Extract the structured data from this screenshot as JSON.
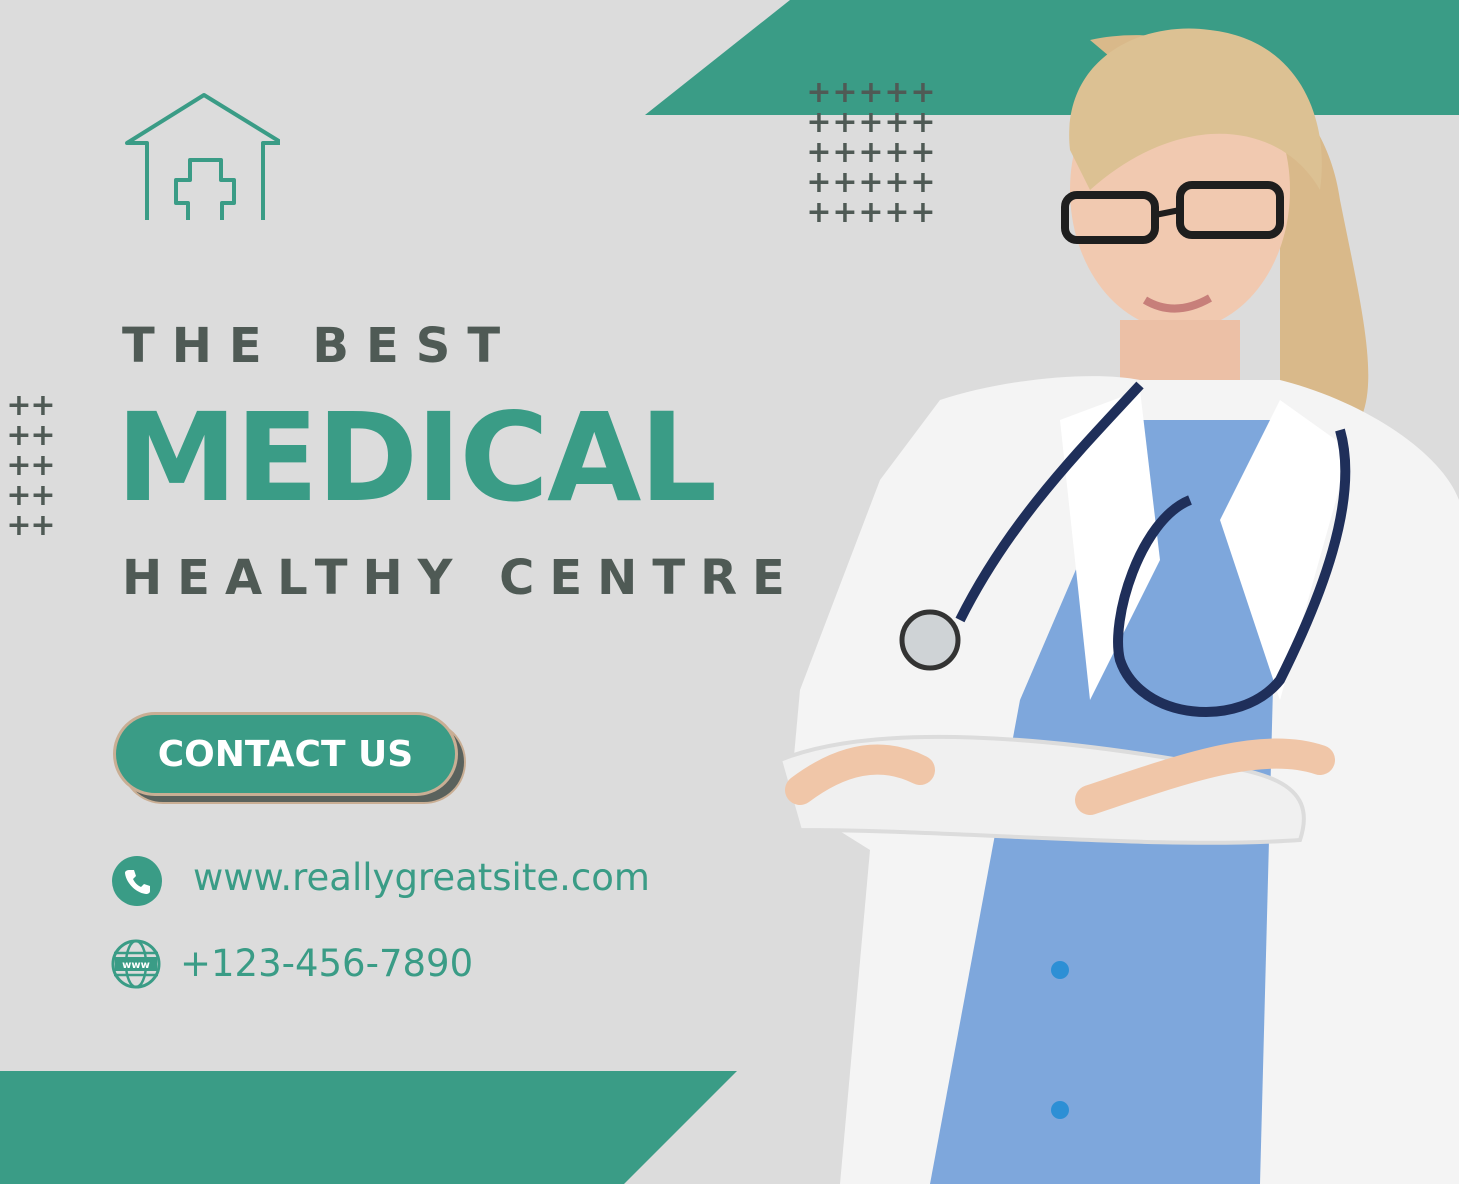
{
  "headline": {
    "tagline_top": "THE BEST",
    "title": "MEDICAL",
    "tagline_bottom": "HEALTHY CENTRE"
  },
  "cta": {
    "label": "CONTACT US"
  },
  "contact": {
    "website": "www.reallygreatsite.com",
    "phone": "+123-456-7890",
    "globe_label": "www"
  },
  "colors": {
    "background": "#dcdcdc",
    "accent": "#3a9c86",
    "text_dark": "#4f5a55"
  }
}
